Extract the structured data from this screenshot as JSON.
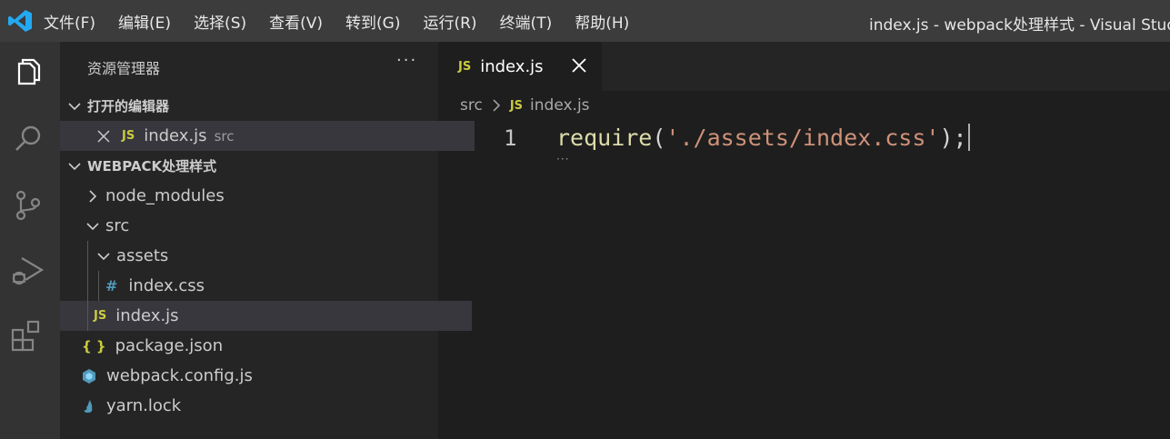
{
  "menu": [
    "文件(F)",
    "编辑(E)",
    "选择(S)",
    "查看(V)",
    "转到(G)",
    "运行(R)",
    "终端(T)",
    "帮助(H)"
  ],
  "window_title": "index.js - webpack处理样式 - Visual Studio",
  "sidebar": {
    "title": "资源管理器",
    "more": "···",
    "open_editors": {
      "header": "打开的编辑器",
      "items": [
        {
          "icon": "JS",
          "name": "index.js",
          "path": "src"
        }
      ]
    },
    "workspace": {
      "header": "WEBPACK处理样式",
      "items": [
        {
          "name": "node_modules"
        },
        {
          "name": "src"
        },
        {
          "name": "assets"
        },
        {
          "icon": "#",
          "name": "index.css"
        },
        {
          "icon": "JS",
          "name": "index.js"
        },
        {
          "icon": "{ }",
          "name": "package.json"
        },
        {
          "name": "webpack.config.js"
        },
        {
          "name": "yarn.lock"
        }
      ]
    }
  },
  "tab": {
    "icon": "JS",
    "label": "index.js"
  },
  "breadcrumb": {
    "folder": "src",
    "icon": "JS",
    "file": "index.js"
  },
  "editor": {
    "line_number": "1",
    "code": {
      "fn": "require",
      "open": "(",
      "string": "'./assets/index.css'",
      "close": ");"
    },
    "hint": "···"
  }
}
